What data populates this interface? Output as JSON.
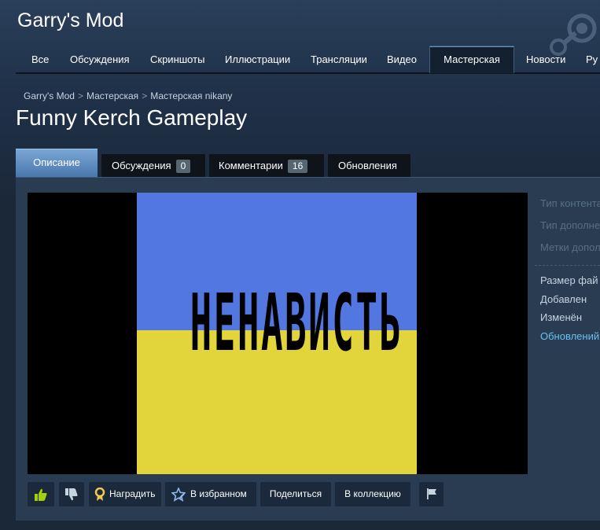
{
  "app": {
    "title": "Garry's Mod"
  },
  "nav": {
    "tabs": [
      {
        "label": "Все"
      },
      {
        "label": "Обсуждения"
      },
      {
        "label": "Скриншоты"
      },
      {
        "label": "Иллюстрации"
      },
      {
        "label": "Трансляции"
      },
      {
        "label": "Видео"
      },
      {
        "label": "Мастерская",
        "active": true
      },
      {
        "label": "Новости"
      },
      {
        "label": "Ру"
      }
    ]
  },
  "breadcrumb": {
    "items": [
      "Garry's Mod",
      "Мастерская",
      "Мастерская nikany"
    ],
    "separator": ">"
  },
  "page": {
    "title": "Funny Kerch Gameplay"
  },
  "detail_tabs": [
    {
      "label": "Описание",
      "active": true
    },
    {
      "label": "Обсуждения",
      "count": "0"
    },
    {
      "label": "Комментарии",
      "count": "16"
    },
    {
      "label": "Обновления"
    }
  ],
  "video": {
    "caption": "НЕНАВИСТЬ",
    "colors": {
      "top": "#5277e0",
      "bottom": "#e2d53b"
    }
  },
  "sidebar": {
    "labels": [
      "Тип контента",
      "Тип дополне",
      "Метки допол"
    ],
    "stats": [
      "Размер фай",
      "Добавлен",
      "Изменён"
    ],
    "link": "Обновлений"
  },
  "actions": {
    "award": "Наградить",
    "favorite": "В избранном",
    "share": "Поделиться",
    "collection": "В коллекцию"
  },
  "colors": {
    "background": "#1b2838",
    "accent": "#66c0f4",
    "active_tab": "#4a78ab",
    "thumb_up": "#a4d007"
  }
}
